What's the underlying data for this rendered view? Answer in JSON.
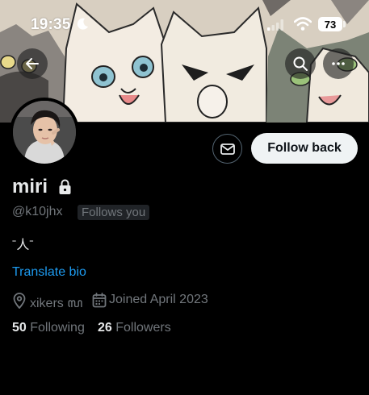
{
  "status_bar": {
    "time": "19:35",
    "battery": "73",
    "icons": [
      "moon-icon",
      "signal-icon",
      "wifi-icon",
      "battery-icon"
    ]
  },
  "header": {
    "buttons": [
      "back-arrow-icon",
      "search-icon",
      "more-icon"
    ]
  },
  "profile": {
    "display_name": "miri",
    "protected_icon": "lock-icon",
    "handle": "@k10jhx",
    "follows_you": "Follows you",
    "bio": "ˉ人ˉ",
    "translate_bio": "Translate bio",
    "location": "xikers ꦭ",
    "joined": "Joined April 2023",
    "following_count": "50",
    "following_label": "Following",
    "followers_count": "26",
    "followers_label": "Followers"
  },
  "actions": {
    "message_icon": "envelope-icon",
    "follow_back_label": "Follow back"
  },
  "colors": {
    "background": "#000000",
    "primary_text": "#e7e9ea",
    "secondary_text": "#71767b",
    "link": "#1d9bf0",
    "follow_button_bg": "#eff3f4"
  }
}
